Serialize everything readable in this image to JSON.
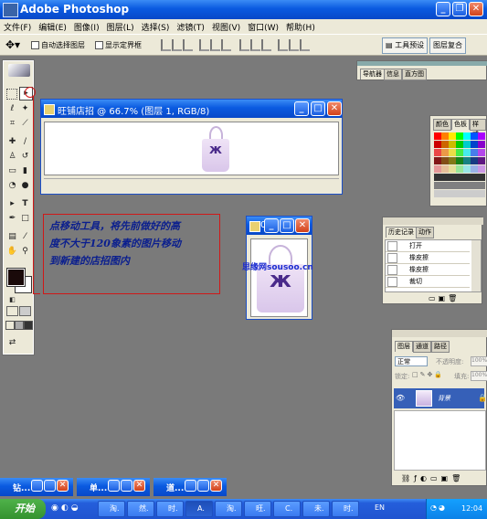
{
  "app": {
    "title": "Adobe Photoshop"
  },
  "menu": [
    "文件(F)",
    "编辑(E)",
    "图像(I)",
    "图层(L)",
    "选择(S)",
    "滤镜(T)",
    "视图(V)",
    "窗口(W)",
    "帮助(H)"
  ],
  "options": {
    "auto_select": "自动选择图层",
    "show_bounds": "显示定界框",
    "tool_presets": "工具预设",
    "palette_well": "图层复合"
  },
  "document_main": {
    "title": "旺铺店招 @ 66.7% (图层 1, RGB/8)"
  },
  "document_small": {
    "title": "0."
  },
  "callout": {
    "line1": "点移动工具，将先前做好的高",
    "line2": "度不大于120象素的图片移动",
    "line3": "到新建的店招图内"
  },
  "watermark": "思缘网sousoo.cn",
  "navigator": {
    "tabs": [
      "导航器",
      "信息",
      "直方图"
    ]
  },
  "swatches": {
    "tabs": [
      "颜色",
      "色板",
      "样式"
    ]
  },
  "history": {
    "tabs": [
      "历史记录",
      "动作"
    ],
    "items": [
      "打开",
      "橡皮擦",
      "橡皮擦",
      "裁切"
    ]
  },
  "layers": {
    "tabs": [
      "图层",
      "通道",
      "路径"
    ],
    "blend": "正常",
    "opacity_label": "不透明度:",
    "opacity": "100%",
    "lock_label": "锁定:",
    "fill_label": "填充:",
    "fill": "100%",
    "layer_name": "背景"
  },
  "minimized": [
    "钻...",
    "单...",
    "道..."
  ],
  "taskbar": {
    "start": "开始",
    "tasks": [
      "淘.",
      "然.",
      "时.",
      "A.",
      "淘.",
      "旺.",
      "C.",
      "未.",
      "时."
    ],
    "lang": "EN",
    "clock": "12:04"
  }
}
